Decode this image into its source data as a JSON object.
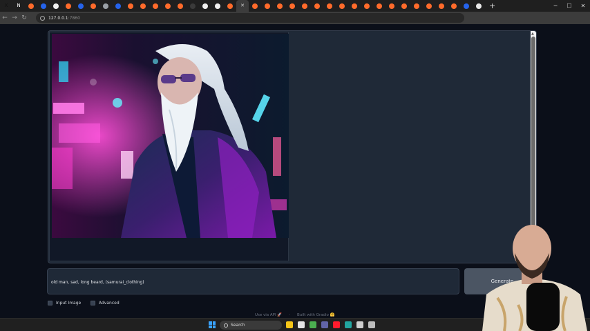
{
  "browser": {
    "tabs": [
      {
        "icon": "x-icon",
        "color": "#111111",
        "glyph": "X"
      },
      {
        "icon": "notion-icon",
        "color": "#ffffff",
        "glyph": "N"
      },
      {
        "icon": "gradio-icon",
        "color": "#ff6b2b",
        "glyph": ""
      },
      {
        "icon": "blue-circle-icon",
        "color": "#2563eb",
        "glyph": ""
      },
      {
        "icon": "github-icon",
        "color": "#f0f0f0",
        "glyph": ""
      },
      {
        "icon": "gradio-icon",
        "color": "#ff6b2b",
        "glyph": ""
      },
      {
        "icon": "blue-circle-icon",
        "color": "#2563eb",
        "glyph": ""
      },
      {
        "icon": "gradio-icon",
        "color": "#ff6b2b",
        "glyph": ""
      },
      {
        "icon": "pen-icon",
        "color": "#9aa0a6",
        "glyph": ""
      },
      {
        "icon": "blue-circle-icon",
        "color": "#2563eb",
        "glyph": ""
      },
      {
        "icon": "gradio-icon",
        "color": "#ff6b2b",
        "glyph": ""
      },
      {
        "icon": "gradio-icon",
        "color": "#ff6b2b",
        "glyph": ""
      },
      {
        "icon": "gradio-icon",
        "color": "#ff6b2b",
        "glyph": ""
      },
      {
        "icon": "gradio-icon",
        "color": "#ff6b2b",
        "glyph": ""
      },
      {
        "icon": "gradio-icon",
        "color": "#ff6b2b",
        "glyph": ""
      },
      {
        "icon": "loading-icon",
        "color": "#3a3a3a",
        "glyph": ""
      },
      {
        "icon": "github-icon",
        "color": "#f0f0f0",
        "glyph": ""
      },
      {
        "icon": "github-icon",
        "color": "#f0f0f0",
        "glyph": ""
      },
      {
        "icon": "gradio-icon",
        "color": "#ff6b2b",
        "glyph": ""
      },
      {
        "icon": "close-tab-icon",
        "color": "#cccccc",
        "glyph": "✕"
      },
      {
        "icon": "gradio-icon",
        "color": "#ff6b2b",
        "glyph": ""
      },
      {
        "icon": "gradio-icon",
        "color": "#ff6b2b",
        "glyph": ""
      },
      {
        "icon": "gradio-icon",
        "color": "#ff6b2b",
        "glyph": ""
      },
      {
        "icon": "gradio-icon",
        "color": "#ff6b2b",
        "glyph": ""
      },
      {
        "icon": "gradio-icon",
        "color": "#ff6b2b",
        "glyph": ""
      },
      {
        "icon": "gradio-icon",
        "color": "#ff6b2b",
        "glyph": ""
      },
      {
        "icon": "gradio-icon",
        "color": "#ff6b2b",
        "glyph": ""
      },
      {
        "icon": "gradio-icon",
        "color": "#ff6b2b",
        "glyph": ""
      },
      {
        "icon": "gradio-icon",
        "color": "#ff6b2b",
        "glyph": ""
      },
      {
        "icon": "gradio-icon",
        "color": "#ff6b2b",
        "glyph": ""
      },
      {
        "icon": "gradio-icon",
        "color": "#ff6b2b",
        "glyph": ""
      },
      {
        "icon": "gradio-icon",
        "color": "#ff6b2b",
        "glyph": ""
      },
      {
        "icon": "gradio-icon",
        "color": "#ff6b2b",
        "glyph": ""
      },
      {
        "icon": "gradio-icon",
        "color": "#ff6b2b",
        "glyph": ""
      },
      {
        "icon": "gradio-icon",
        "color": "#ff6b2b",
        "glyph": ""
      },
      {
        "icon": "gradio-icon",
        "color": "#ff6b2b",
        "glyph": ""
      },
      {
        "icon": "gradio-icon",
        "color": "#ff6b2b",
        "glyph": ""
      },
      {
        "icon": "blue-circle-icon",
        "color": "#2563eb",
        "glyph": ""
      },
      {
        "icon": "chrome-icon",
        "color": "#e8e8e8",
        "glyph": ""
      }
    ],
    "new_tab_glyph": "+",
    "url_host": "127.0.0.1",
    "url_port": ":7860"
  },
  "app": {
    "prompt_text": "old man, sad, long beard, (samurai_clothing)",
    "generate_label": "Generate",
    "input_image_label": "Input Image",
    "advanced_label": "Advanced",
    "footer_api": "Use via API 🚀",
    "footer_built": "Built with Gradio 🤗"
  },
  "taskbar": {
    "search_label": "Search",
    "apps": [
      {
        "icon": "file-explorer-icon",
        "color": "#f5c518"
      },
      {
        "icon": "store-icon",
        "color": "#e5e5e5"
      },
      {
        "icon": "chrome-icon",
        "color": "#4caf50"
      },
      {
        "icon": "teams-icon",
        "color": "#6264a7"
      },
      {
        "icon": "opera-icon",
        "color": "#ff1b2d"
      },
      {
        "icon": "app-icon",
        "color": "#22a6a0"
      },
      {
        "icon": "obs-icon",
        "color": "#cfcfcf"
      },
      {
        "icon": "settings-icon",
        "color": "#bdbdbd"
      }
    ]
  }
}
